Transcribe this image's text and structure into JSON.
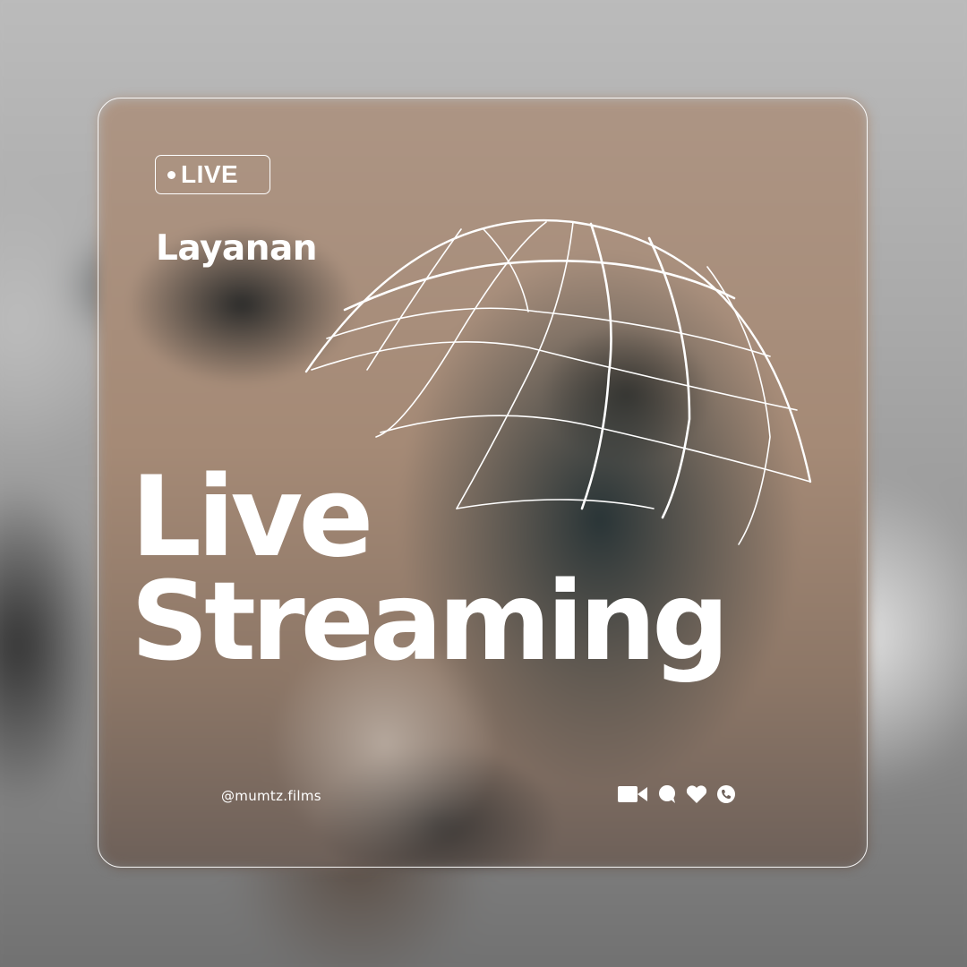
{
  "badge": {
    "label": "LIVE"
  },
  "service": {
    "label": "Layanan"
  },
  "headline": {
    "line1": "Live",
    "line2": "Streaming"
  },
  "footer": {
    "handle": "@mumtz.films",
    "icons": [
      "video-camera-icon",
      "chat-bubble-icon",
      "heart-icon",
      "phone-icon"
    ]
  },
  "colors": {
    "text": "#ffffff",
    "frame": "#ffffff",
    "card_tint": "#a58a76"
  }
}
